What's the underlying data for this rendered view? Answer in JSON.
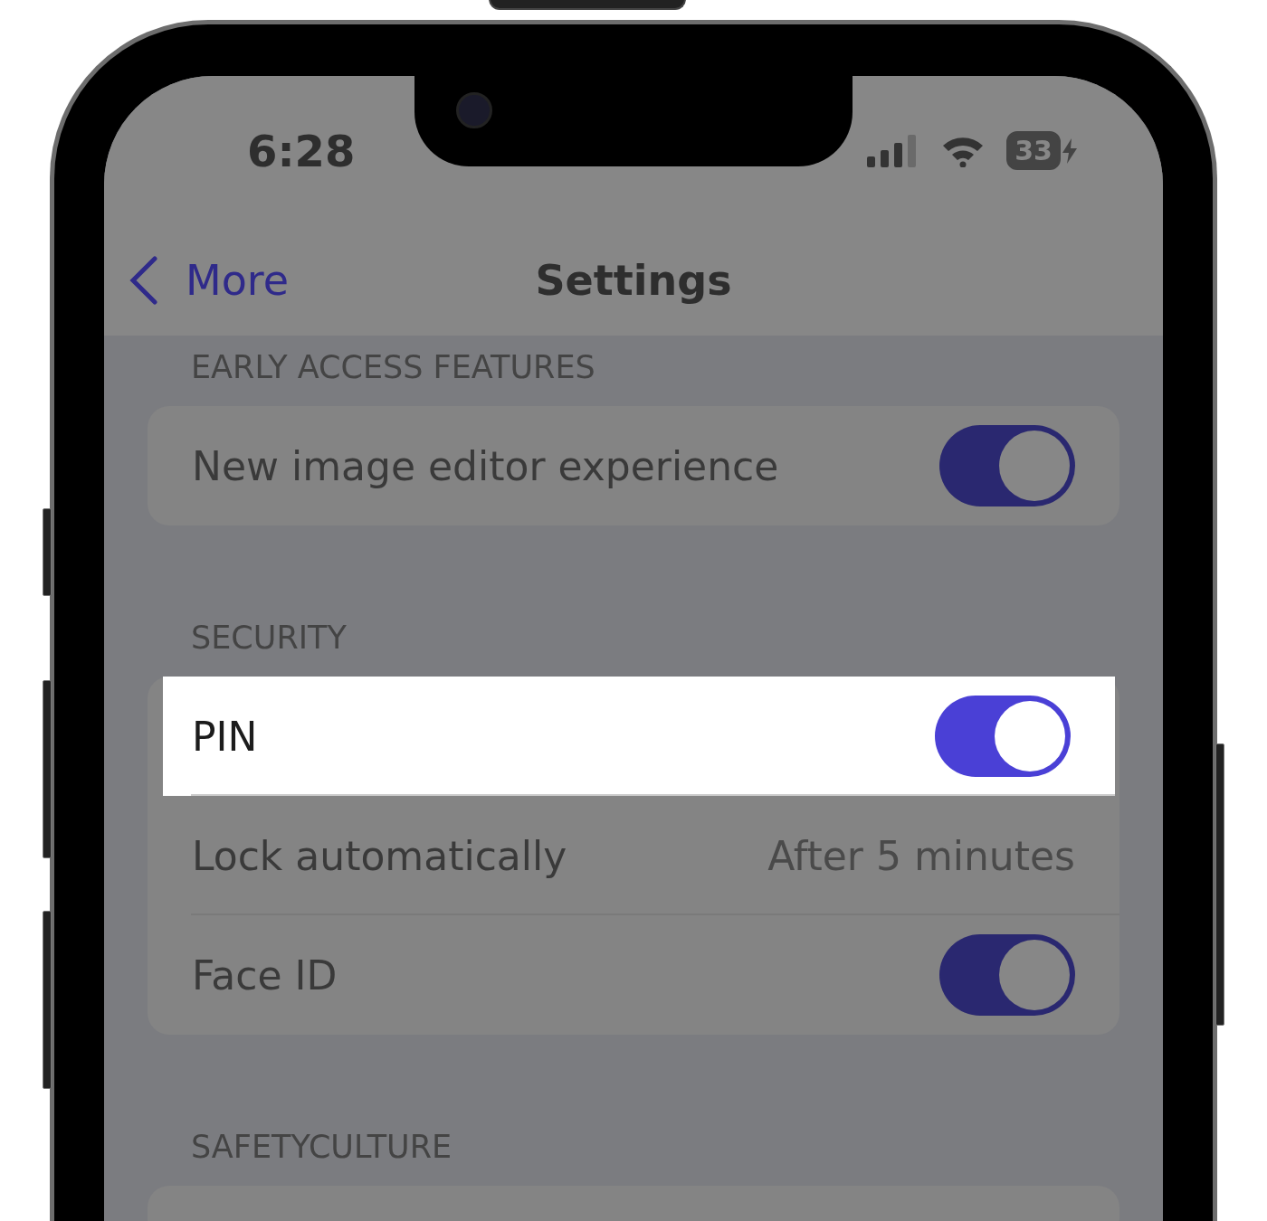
{
  "status_bar": {
    "time": "6:28",
    "battery": "33",
    "charging": true
  },
  "nav": {
    "back": "More",
    "title": "Settings"
  },
  "sections": [
    {
      "header": "EARLY ACCESS FEATURES",
      "rows": [
        {
          "kind": "toggle",
          "label": "New image editor experience",
          "on": true,
          "highlighted": false
        }
      ]
    },
    {
      "header": "SECURITY",
      "rows": [
        {
          "kind": "toggle",
          "label": "PIN",
          "on": true,
          "highlighted": true
        },
        {
          "kind": "value",
          "label": "Lock automatically",
          "value": "After 5 minutes",
          "highlighted": false
        },
        {
          "kind": "toggle",
          "label": "Face ID",
          "on": true,
          "highlighted": false
        }
      ]
    },
    {
      "header": "SAFETYCULTURE"
    }
  ]
}
